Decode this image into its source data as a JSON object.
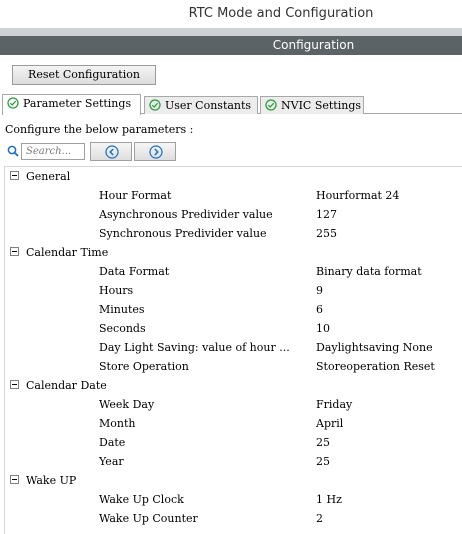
{
  "window": {
    "title": "RTC Mode and Configuration"
  },
  "config_bar": {
    "label": "Configuration"
  },
  "reset_button": {
    "label": "Reset Configuration"
  },
  "tabs": [
    {
      "label": "Parameter Settings",
      "active": true
    },
    {
      "label": "User Constants",
      "active": false
    },
    {
      "label": "NVIC Settings",
      "active": false
    }
  ],
  "configure_label": "Configure the below parameters :",
  "search": {
    "placeholder": "Search..."
  },
  "groups": [
    {
      "name": "General",
      "params": [
        {
          "name": "Hour Format",
          "value": "Hourformat 24"
        },
        {
          "name": "Asynchronous Predivider value",
          "value": "127"
        },
        {
          "name": "Synchronous Predivider value",
          "value": "255"
        }
      ]
    },
    {
      "name": "Calendar Time",
      "params": [
        {
          "name": "Data Format",
          "value": "Binary data format"
        },
        {
          "name": "Hours",
          "value": "9"
        },
        {
          "name": "Minutes",
          "value": "6"
        },
        {
          "name": "Seconds",
          "value": "10"
        },
        {
          "name": "Day Light Saving: value of hour ...",
          "value": "Daylightsaving None"
        },
        {
          "name": "Store Operation",
          "value": "Storeoperation Reset"
        }
      ]
    },
    {
      "name": "Calendar Date",
      "params": [
        {
          "name": "Week Day",
          "value": "Friday"
        },
        {
          "name": "Month",
          "value": "April"
        },
        {
          "name": "Date",
          "value": "25"
        },
        {
          "name": "Year",
          "value": "25"
        }
      ]
    },
    {
      "name": "Wake UP",
      "params": [
        {
          "name": "Wake Up Clock",
          "value": "1 Hz"
        },
        {
          "name": "Wake Up Counter",
          "value": "2"
        }
      ]
    }
  ],
  "colors": {
    "config_bar_bg": "#5c6367",
    "check_icon": "#2e9e3e",
    "nav_icon": "#1b6fbf",
    "search_icon": "#1b6fbf"
  }
}
